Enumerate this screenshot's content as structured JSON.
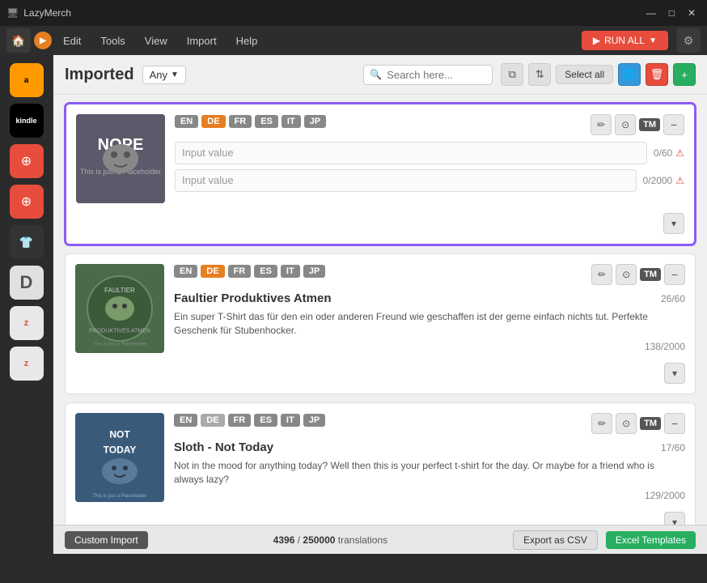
{
  "app": {
    "title": "LazyMerch",
    "titlebar_title": "LazyMerch"
  },
  "titlebar": {
    "minimize": "—",
    "maximize": "□",
    "close": "✕"
  },
  "menubar": {
    "edit": "Edit",
    "tools": "Tools",
    "view": "View",
    "import": "Import",
    "help": "Help",
    "run_all": "RUN ALL"
  },
  "header": {
    "title": "Imported",
    "filter": "Any",
    "search_placeholder": "Search here...",
    "select_all": "Select all"
  },
  "cards": [
    {
      "id": 1,
      "selected": true,
      "title": "Input value",
      "title_input_placeholder": "Input value",
      "desc_input_placeholder": "Input value",
      "title_count": "0/60",
      "desc_count": "0/2000",
      "lang_active": "DE",
      "langs": [
        "EN",
        "DE",
        "FR",
        "ES",
        "IT",
        "JP"
      ],
      "image_bg": "#7a7a7a",
      "image_text": "NOPE",
      "description": "",
      "tm": "TM"
    },
    {
      "id": 2,
      "selected": false,
      "title": "Faultier Produktives Atmen",
      "title_count": "26/60",
      "desc_count": "138/2000",
      "lang_active": "DE",
      "langs": [
        "EN",
        "DE",
        "FR",
        "ES",
        "IT",
        "JP"
      ],
      "image_bg": "#5a7a5a",
      "image_text": "FAULTIER",
      "description": "Ein super T-Shirt das für den ein oder anderen Freund wie geschaffen ist der gerne einfach nichts tut. Perfekte Geschenk für Stubenhocker.",
      "tm": "TM"
    },
    {
      "id": 3,
      "selected": false,
      "title": "Sloth - Not Today",
      "title_count": "17/60",
      "desc_count": "129/2000",
      "lang_active": "DE",
      "langs": [
        "EN",
        "DE",
        "FR",
        "ES",
        "IT",
        "JP"
      ],
      "image_bg": "#4a6a8a",
      "image_text": "NOT TODAY",
      "description": "Not in the mood for anything today? Well then this is your perfect t-shirt for the day. Or maybe for a friend who is always lazy?",
      "tm": "TM"
    }
  ],
  "footer": {
    "custom_import": "Custom Import",
    "translations_current": "4396",
    "translations_total": "250000",
    "translations_label": "translations",
    "export_csv": "Export as CSV",
    "excel_templates": "Excel Templates"
  },
  "sidebar": {
    "icons": [
      {
        "name": "amazon",
        "label": "Amazon"
      },
      {
        "name": "kindle",
        "label": "Kindle"
      },
      {
        "name": "redbubble1",
        "label": "Redbubble"
      },
      {
        "name": "redbubble2",
        "label": "Redbubble 2"
      },
      {
        "name": "merch",
        "label": "Merch by Amazon"
      },
      {
        "name": "designerino",
        "label": "Designerino"
      },
      {
        "name": "zazzle1",
        "label": "Zazzle"
      },
      {
        "name": "zazzle2",
        "label": "Zazzle 2"
      }
    ]
  }
}
